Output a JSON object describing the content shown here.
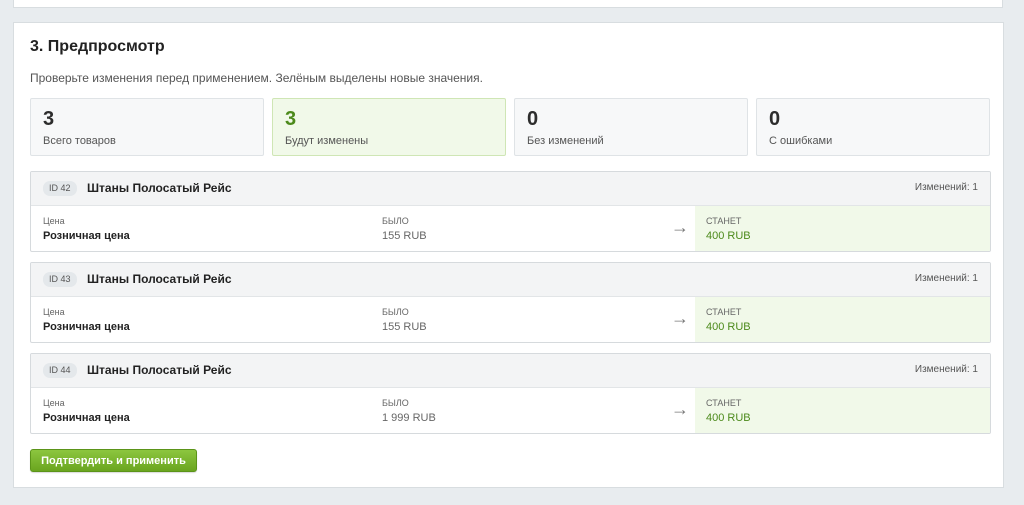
{
  "section": {
    "title": "3. Предпросмотр",
    "hint": "Проверьте изменения перед применением. Зелёным выделены новые значения."
  },
  "stats": [
    {
      "value": "3",
      "label": "Всего товаров"
    },
    {
      "value": "3",
      "label": "Будут изменены"
    },
    {
      "value": "0",
      "label": "Без изменений"
    },
    {
      "value": "0",
      "label": "С ошибками"
    }
  ],
  "items": [
    {
      "id": "ID 42",
      "name": "Штаны Полосатый Рейс",
      "changes": "Изменений: 1",
      "field_caption": "Цена",
      "field_name": "Розничная цена",
      "old_caption": "БЫЛО",
      "old_value": "155 RUB",
      "arrow": "→",
      "new_caption": "СТАНЕТ",
      "new_value": "400 RUB"
    },
    {
      "id": "ID 43",
      "name": "Штаны Полосатый Рейс",
      "changes": "Изменений: 1",
      "field_caption": "Цена",
      "field_name": "Розничная цена",
      "old_caption": "БЫЛО",
      "old_value": "155 RUB",
      "arrow": "→",
      "new_caption": "СТАНЕТ",
      "new_value": "400 RUB"
    },
    {
      "id": "ID 44",
      "name": "Штаны Полосатый Рейс",
      "changes": "Изменений: 1",
      "field_caption": "Цена",
      "field_name": "Розничная цена",
      "old_caption": "БЫЛО",
      "old_value": "1 999 RUB",
      "arrow": "→",
      "new_caption": "СТАНЕТ",
      "new_value": "400 RUB"
    }
  ],
  "actions": {
    "apply_label": "Подтвердить и применить"
  },
  "colors": {
    "accent_green": "#6aa51f",
    "new_value_bg": "#f1f9e9",
    "new_value_text": "#4c8a1b"
  }
}
